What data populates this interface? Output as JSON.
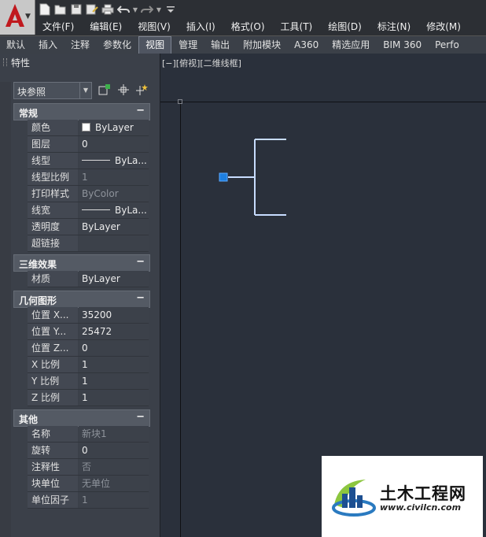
{
  "quick_access": {
    "icons": [
      "new-icon",
      "open-icon",
      "save-icon",
      "save-as-icon",
      "print-icon",
      "undo-icon",
      "redo-icon",
      "customize-icon"
    ]
  },
  "menubar": {
    "items": [
      "文件(F)",
      "编辑(E)",
      "视图(V)",
      "插入(I)",
      "格式(O)",
      "工具(T)",
      "绘图(D)",
      "标注(N)",
      "修改(M)"
    ]
  },
  "ribbon": {
    "tabs": [
      "默认",
      "插入",
      "注释",
      "参数化",
      "视图",
      "管理",
      "输出",
      "附加模块",
      "A360",
      "精选应用",
      "BIM 360",
      "Perfo"
    ],
    "active_tab": "视图"
  },
  "palette": {
    "title": "特性",
    "selector": "块参照",
    "sections": {
      "general": {
        "title": "常规",
        "toggle": "−",
        "rows": [
          {
            "name": "颜色",
            "value": "ByLayer"
          },
          {
            "name": "图层",
            "value": "0"
          },
          {
            "name": "线型",
            "value": "ByLa..."
          },
          {
            "name": "线型比例",
            "value": "1"
          },
          {
            "name": "打印样式",
            "value": "ByColor"
          },
          {
            "name": "线宽",
            "value": "ByLa..."
          },
          {
            "name": "透明度",
            "value": "ByLayer"
          },
          {
            "name": "超链接",
            "value": ""
          }
        ]
      },
      "threed": {
        "title": "三维效果",
        "toggle": "−",
        "rows": [
          {
            "name": "材质",
            "value": "ByLayer"
          }
        ]
      },
      "geometry": {
        "title": "几何图形",
        "toggle": "−",
        "rows": [
          {
            "name": "位置 X...",
            "value": "35200"
          },
          {
            "name": "位置 Y...",
            "value": "25472"
          },
          {
            "name": "位置 Z...",
            "value": "0"
          },
          {
            "name": "X 比例",
            "value": "1"
          },
          {
            "name": "Y 比例",
            "value": "1"
          },
          {
            "name": "Z 比例",
            "value": "1"
          }
        ]
      },
      "misc": {
        "title": "其他",
        "toggle": "−",
        "rows": [
          {
            "name": "名称",
            "value": "新块1"
          },
          {
            "name": "旋转",
            "value": "0"
          },
          {
            "name": "注释性",
            "value": "否"
          },
          {
            "name": "块单位",
            "value": "无单位"
          },
          {
            "name": "单位因子",
            "value": "1"
          }
        ]
      }
    }
  },
  "viewport": {
    "label": "[−][俯视][二维线框]",
    "line_color": "#c8dcff",
    "grip_color": "#1e7fe0"
  },
  "watermark": {
    "title": "土木工程网",
    "url": "www.civilcn.com"
  },
  "colors": {
    "app_red": "#c0191e",
    "canvas": "#2a303b",
    "panel": "#3b4049"
  }
}
